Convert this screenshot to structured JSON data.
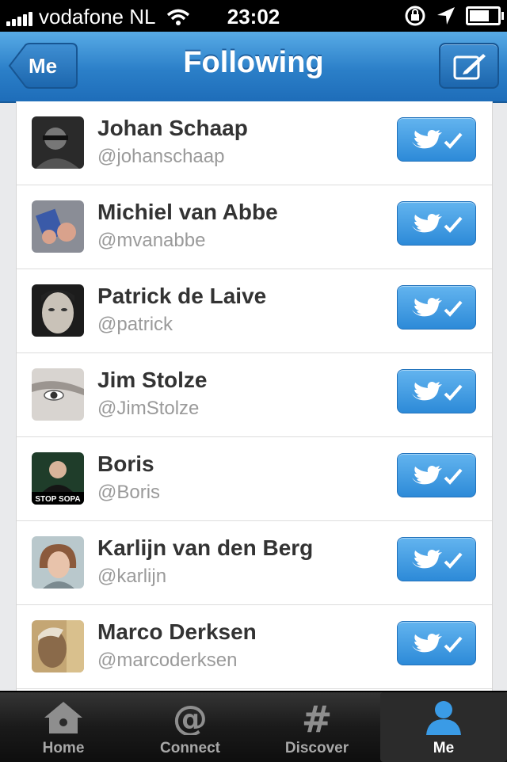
{
  "status": {
    "carrier": "vodafone NL",
    "time": "23:02",
    "battery_level": 0.7,
    "signal_bars": 5
  },
  "nav": {
    "back_label": "Me",
    "title": "Following"
  },
  "following": [
    {
      "name": "Johan Schaap",
      "handle": "@johanschaap",
      "avatar": "photo-dark"
    },
    {
      "name": "Michiel van Abbe",
      "handle": "@mvanabbe",
      "avatar": "photo-hands"
    },
    {
      "name": "Patrick de Laive",
      "handle": "@patrick",
      "avatar": "photo-face"
    },
    {
      "name": "Jim Stolze",
      "handle": "@JimStolze",
      "avatar": "photo-eye"
    },
    {
      "name": "Boris",
      "handle": "@Boris",
      "avatar": "photo-suit",
      "avatar_caption": "STOP SOPA"
    },
    {
      "name": "Karlijn van den Berg",
      "handle": "@karlijn",
      "avatar": "photo-woman"
    },
    {
      "name": "Marco Derksen",
      "handle": "@marcoderksen",
      "avatar": "photo-man"
    }
  ],
  "tabs": [
    {
      "label": "Home",
      "icon": "house-icon",
      "active": false
    },
    {
      "label": "Connect",
      "icon": "at-icon",
      "active": false
    },
    {
      "label": "Discover",
      "icon": "hash-icon",
      "active": false
    },
    {
      "label": "Me",
      "icon": "person-icon",
      "active": true
    }
  ],
  "colors": {
    "nav_blue": "#2b7fc8",
    "follow_button": "#3b95de",
    "tabbar": "#1a1a1a"
  }
}
